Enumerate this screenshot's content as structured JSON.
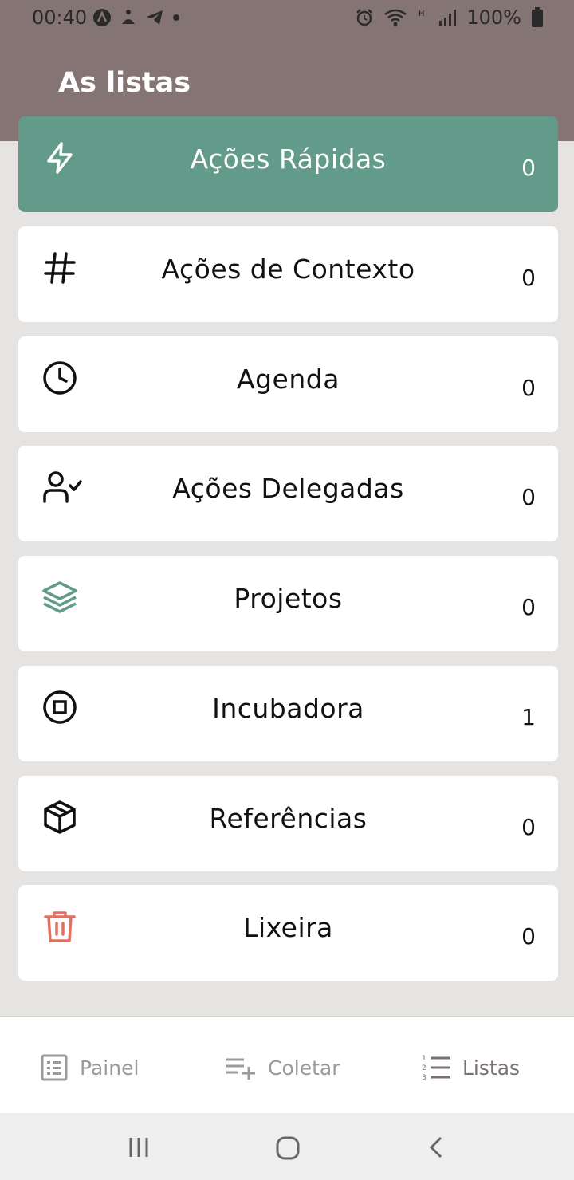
{
  "status": {
    "time": "00:40",
    "battery": "100%"
  },
  "header": {
    "title": "As listas"
  },
  "lists": [
    {
      "label": "Ações Rápidas",
      "count": "0",
      "icon": "lightning-icon"
    },
    {
      "label": "Ações de Contexto",
      "count": "0",
      "icon": "hash-icon"
    },
    {
      "label": "Agenda",
      "count": "0",
      "icon": "clock-icon"
    },
    {
      "label": "Ações Delegadas",
      "count": "0",
      "icon": "user-check-icon"
    },
    {
      "label": "Projetos",
      "count": "0",
      "icon": "layers-icon"
    },
    {
      "label": "Incubadora",
      "count": "1",
      "icon": "stop-circle-icon"
    },
    {
      "label": "Referências",
      "count": "0",
      "icon": "box-icon"
    },
    {
      "label": "Lixeira",
      "count": "0",
      "icon": "trash-icon"
    }
  ],
  "nav": {
    "painel": "Painel",
    "coletar": "Coletar",
    "listas": "Listas"
  },
  "colors": {
    "header": "#857474",
    "accent": "#639b8b",
    "trash": "#e07060",
    "background": "#e5e4e2"
  }
}
